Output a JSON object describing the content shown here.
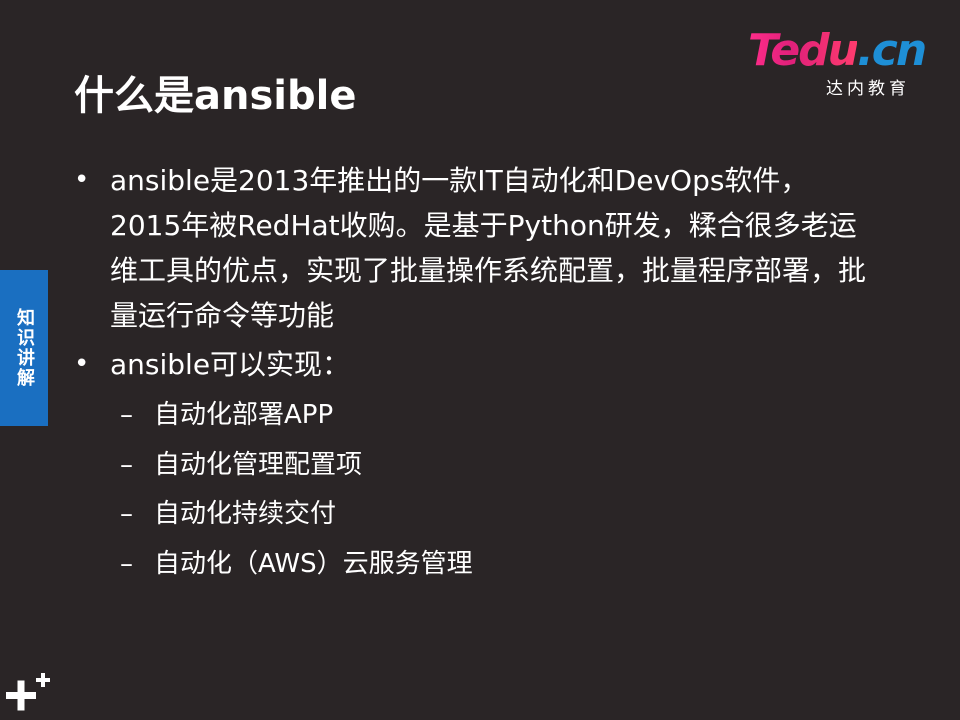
{
  "logo": {
    "brand": "Tedu",
    "suffix": ".cn",
    "subtitle": "达内教育"
  },
  "title": "什么是ansible",
  "side_tab": "知识讲解",
  "bullets": [
    "ansible是2013年推出的一款IT自动化和DevOps软件，2015年被RedHat收购。是基于Python研发，糅合很多老运维工具的优点，实现了批量操作系统配置，批量程序部署，批量运行命令等功能",
    "ansible可以实现："
  ],
  "sub_items": [
    "自动化部署APP",
    "自动化管理配置项",
    "自动化持续交付",
    "自动化（AWS）云服务管理"
  ],
  "colors": {
    "background": "#2a2526",
    "side_tab": "#1a6fc1",
    "logo_brand": "#e0207a",
    "logo_suffix": "#1e8fd6",
    "text": "#ffffff"
  },
  "icons": {
    "corner": "plus-icon"
  }
}
